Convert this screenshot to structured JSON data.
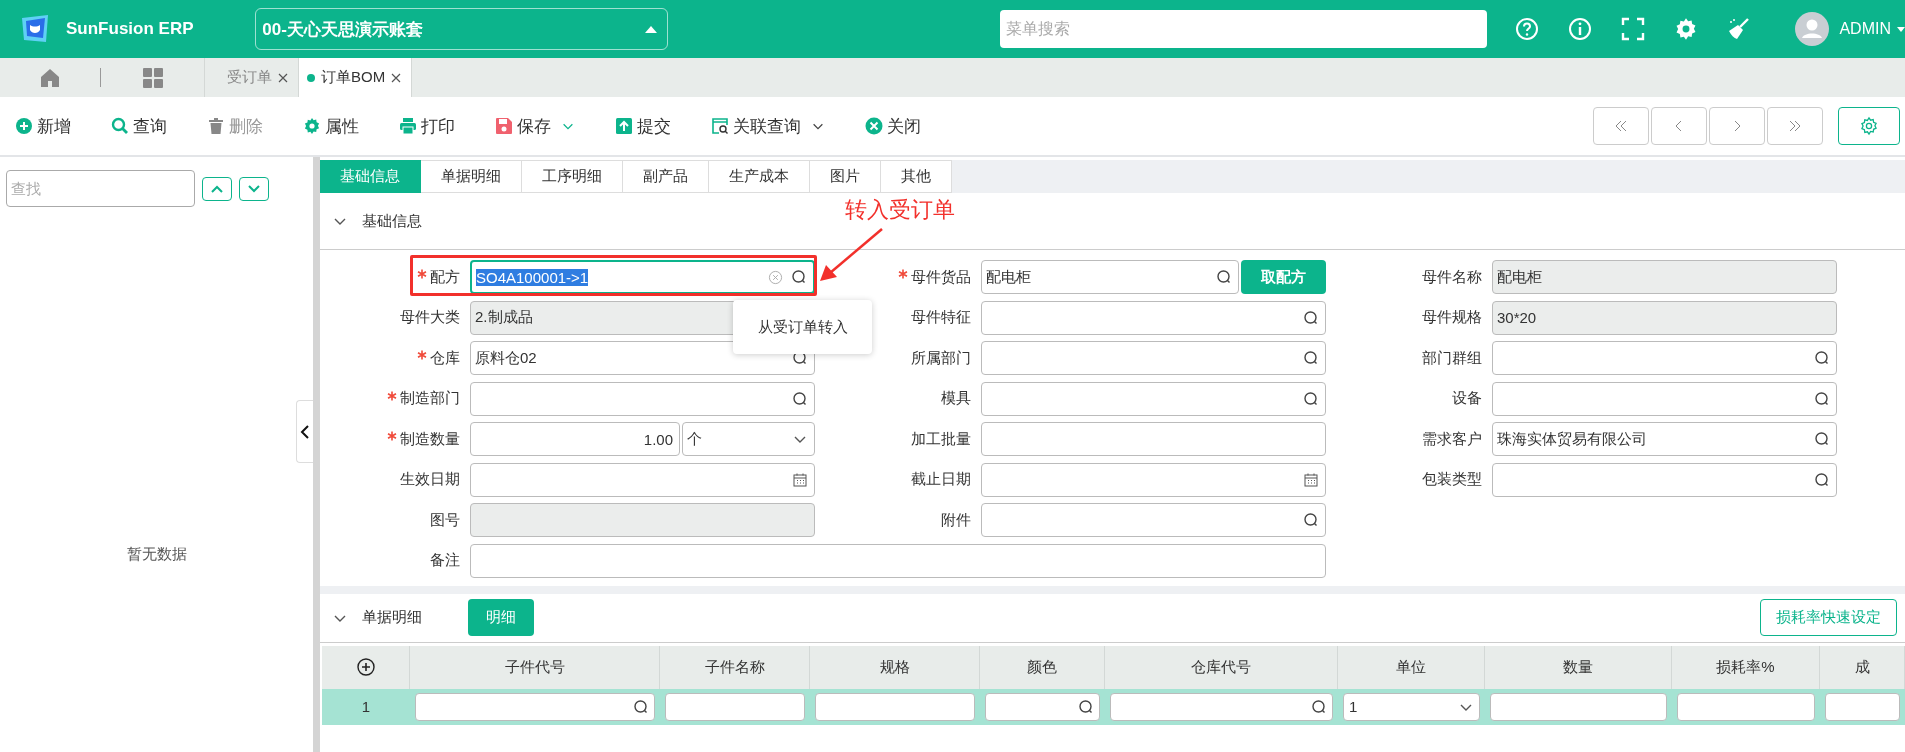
{
  "header": {
    "logo_text": "SunFusion ERP",
    "account": "00-天心天思演示账套",
    "search": {
      "placeholder": "菜单搜索"
    },
    "user": "ADMIN"
  },
  "open_tabs": [
    {
      "label": "受订单",
      "selected": false
    },
    {
      "label": "订单BOM",
      "selected": true
    }
  ],
  "toolbar": {
    "buttons": [
      {
        "label": "新增",
        "disabled": false,
        "dropdown": false
      },
      {
        "label": "查询",
        "disabled": false,
        "dropdown": false
      },
      {
        "label": "删除",
        "disabled": true,
        "dropdown": false
      },
      {
        "label": "属性",
        "disabled": false,
        "dropdown": false
      },
      {
        "label": "打印",
        "disabled": false,
        "dropdown": false
      },
      {
        "label": "保存",
        "disabled": false,
        "dropdown": true
      },
      {
        "label": "提交",
        "disabled": false,
        "dropdown": false
      },
      {
        "label": "关联查询",
        "disabled": false,
        "dropdown": true
      },
      {
        "label": "关闭",
        "disabled": false,
        "dropdown": false
      }
    ]
  },
  "sidebar": {
    "search": {
      "placeholder": "查找"
    },
    "empty_text": "暂无数据"
  },
  "form_tabs": [
    {
      "label": "基础信息",
      "selected": true
    },
    {
      "label": "单据明细",
      "selected": false
    },
    {
      "label": "工序明细",
      "selected": false
    },
    {
      "label": "副产品",
      "selected": false
    },
    {
      "label": "生产成本",
      "selected": false
    },
    {
      "label": "图片",
      "selected": false
    },
    {
      "label": "其他",
      "selected": false
    }
  ],
  "basic_section": {
    "title": "基础信息",
    "expanded": true,
    "annotation": {
      "text": "转入受订单"
    },
    "popup_menu": {
      "items": [
        "从受订单转入"
      ]
    },
    "fields": [
      {
        "label": "配方",
        "kind": "search",
        "required": true,
        "focused": true,
        "value": "SO4A100001->1"
      },
      {
        "label": "母件货品",
        "kind": "search",
        "required": true,
        "focused": false,
        "value": "配电柜",
        "button": "取配方"
      },
      {
        "label": "母件名称",
        "kind": "readonly",
        "required": false,
        "focused": false,
        "value": "配电柜"
      },
      {
        "label": "母件大类",
        "kind": "readonly",
        "required": false,
        "focused": false,
        "value": "2.制成品"
      },
      {
        "label": "母件特征",
        "kind": "search",
        "required": false,
        "focused": false
      },
      {
        "label": "母件规格",
        "kind": "readonly",
        "required": false,
        "focused": false,
        "value": "30*20"
      },
      {
        "label": "仓库",
        "kind": "search",
        "required": true,
        "focused": false,
        "value": "原料仓02"
      },
      {
        "label": "所属部门",
        "kind": "search",
        "required": false,
        "focused": false
      },
      {
        "label": "部门群组",
        "kind": "search",
        "required": false,
        "focused": false
      },
      {
        "label": "制造部门",
        "kind": "search",
        "required": true,
        "focused": false
      },
      {
        "label": "模具",
        "kind": "search",
        "required": false,
        "focused": false
      },
      {
        "label": "设备",
        "kind": "search",
        "required": false,
        "focused": false
      },
      {
        "label": "制造数量",
        "kind": "quantity",
        "required": true,
        "focused": false,
        "value": "1.00",
        "unit": "个"
      },
      {
        "label": "加工批量",
        "kind": "text",
        "required": false,
        "focused": false
      },
      {
        "label": "需求客户",
        "kind": "search",
        "required": false,
        "focused": false,
        "value": "珠海实体贸易有限公司"
      },
      {
        "label": "生效日期",
        "kind": "date",
        "required": false,
        "focused": false
      },
      {
        "label": "截止日期",
        "kind": "date",
        "required": false,
        "focused": false
      },
      {
        "label": "包装类型",
        "kind": "search",
        "required": false,
        "focused": false
      },
      {
        "label": "图号",
        "kind": "readonly",
        "required": false,
        "focused": false
      },
      {
        "label": "附件",
        "kind": "search",
        "required": false,
        "focused": false
      },
      {
        "label": "备注",
        "kind": "note",
        "required": false,
        "focused": false
      }
    ]
  },
  "detail_section": {
    "title": "单据明细",
    "expanded": true,
    "button": "明细",
    "quick_button": "损耗率快速设定",
    "table": {
      "columns": [
        "子件代号",
        "子件名称",
        "规格",
        "颜色",
        "仓库代号",
        "单位",
        "数量",
        "损耗率%",
        "成"
      ],
      "rows": [
        {
          "row_number": "1",
          "selected": true,
          "cells": [
            {
              "kind": "search"
            },
            {
              "kind": "text"
            },
            {
              "kind": "text"
            },
            {
              "kind": "search"
            },
            {
              "kind": "search"
            },
            {
              "kind": "select",
              "value": "1"
            },
            {
              "kind": "text"
            },
            {
              "kind": "text"
            },
            {
              "kind": "text"
            }
          ]
        }
      ]
    }
  }
}
